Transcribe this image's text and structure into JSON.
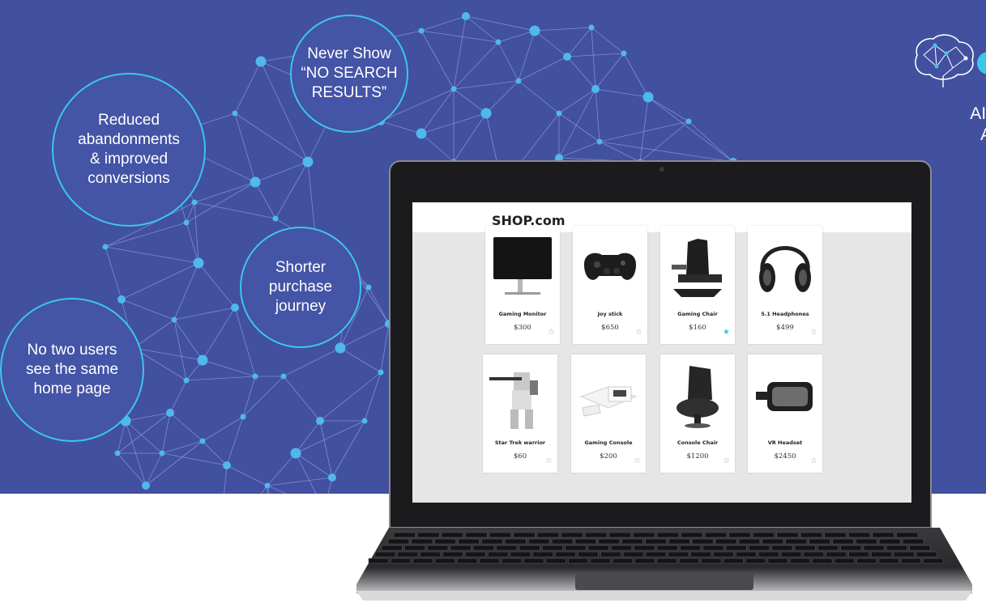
{
  "bubbles": [
    {
      "text": "Never Show\n“NO SEARCH\nRESULTS”"
    },
    {
      "text": "Reduced\nabandonments\n& improved\nconversions"
    },
    {
      "text": "Shorter\npurchase\njourney"
    },
    {
      "text": "No two users\nsee the same\nhome page"
    }
  ],
  "tagline": "AI-dr\nAt",
  "colors": {
    "background": "#4250a0",
    "accent": "#3cc7e6",
    "node": "#4fb8ec"
  },
  "shop": {
    "title": "SHOP.com",
    "products": [
      {
        "name": "Gaming Monitor",
        "price": "$300",
        "icon": "monitor-image",
        "starred": false
      },
      {
        "name": "Joy stick",
        "price": "$650",
        "icon": "gamepad-image",
        "starred": false
      },
      {
        "name": "Gaming Chair",
        "price": "$160",
        "icon": "gaming-chair-image",
        "starred": true
      },
      {
        "name": "5.1 Headphones",
        "price": "$499",
        "icon": "headphones-image",
        "starred": false
      },
      {
        "name": "Star Trek warrior",
        "price": "$60",
        "icon": "robot-figure-image",
        "starred": false
      },
      {
        "name": "Gaming Console",
        "price": "$200",
        "icon": "console-image",
        "starred": false
      },
      {
        "name": "Console Chair",
        "price": "$1200",
        "icon": "console-chair-image",
        "starred": false
      },
      {
        "name": "VR Headset",
        "price": "$2450",
        "icon": "vr-headset-image",
        "starred": false
      }
    ]
  }
}
